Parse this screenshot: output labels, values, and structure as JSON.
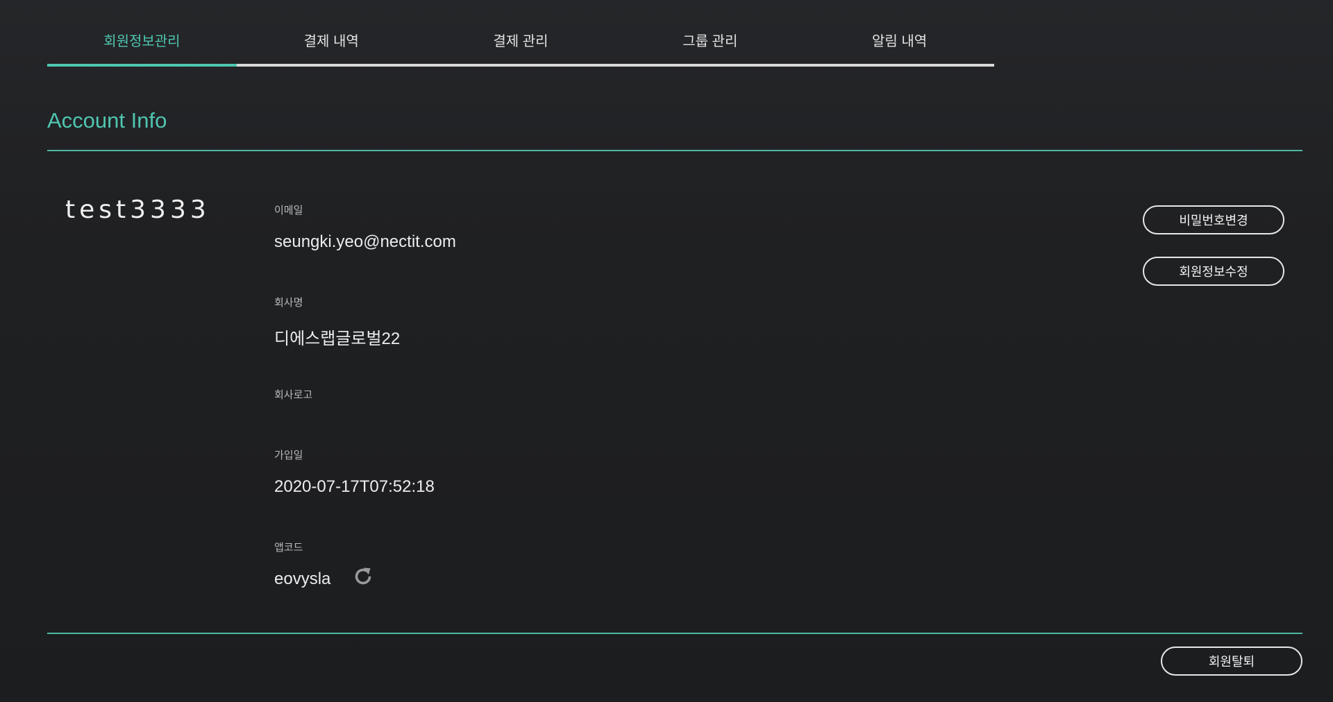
{
  "tabs": [
    {
      "label": "회원정보관리",
      "active": true
    },
    {
      "label": "결제 내역",
      "active": false
    },
    {
      "label": "결제 관리",
      "active": false
    },
    {
      "label": "그룹 관리",
      "active": false
    },
    {
      "label": "알림 내역",
      "active": false
    }
  ],
  "section_title": "Account Info",
  "username": "test3333",
  "fields": {
    "email": {
      "label": "이메일",
      "value": "seungki.yeo@nectit.com"
    },
    "company": {
      "label": "회사명",
      "value": "디에스랩글로벌22"
    },
    "logo": {
      "label": "회사로고",
      "value": ""
    },
    "joined": {
      "label": "가입일",
      "value": "2020-07-17T07:52:18"
    },
    "appcode": {
      "label": "앱코드",
      "value": "eovysla"
    }
  },
  "buttons": {
    "change_password": "비밀번호변경",
    "edit_info": "회원정보수정",
    "withdraw": "회원탈퇴"
  },
  "icons": {
    "refresh": "refresh-icon"
  },
  "colors": {
    "accent": "#4fc6b0",
    "background": "#1f2022"
  }
}
